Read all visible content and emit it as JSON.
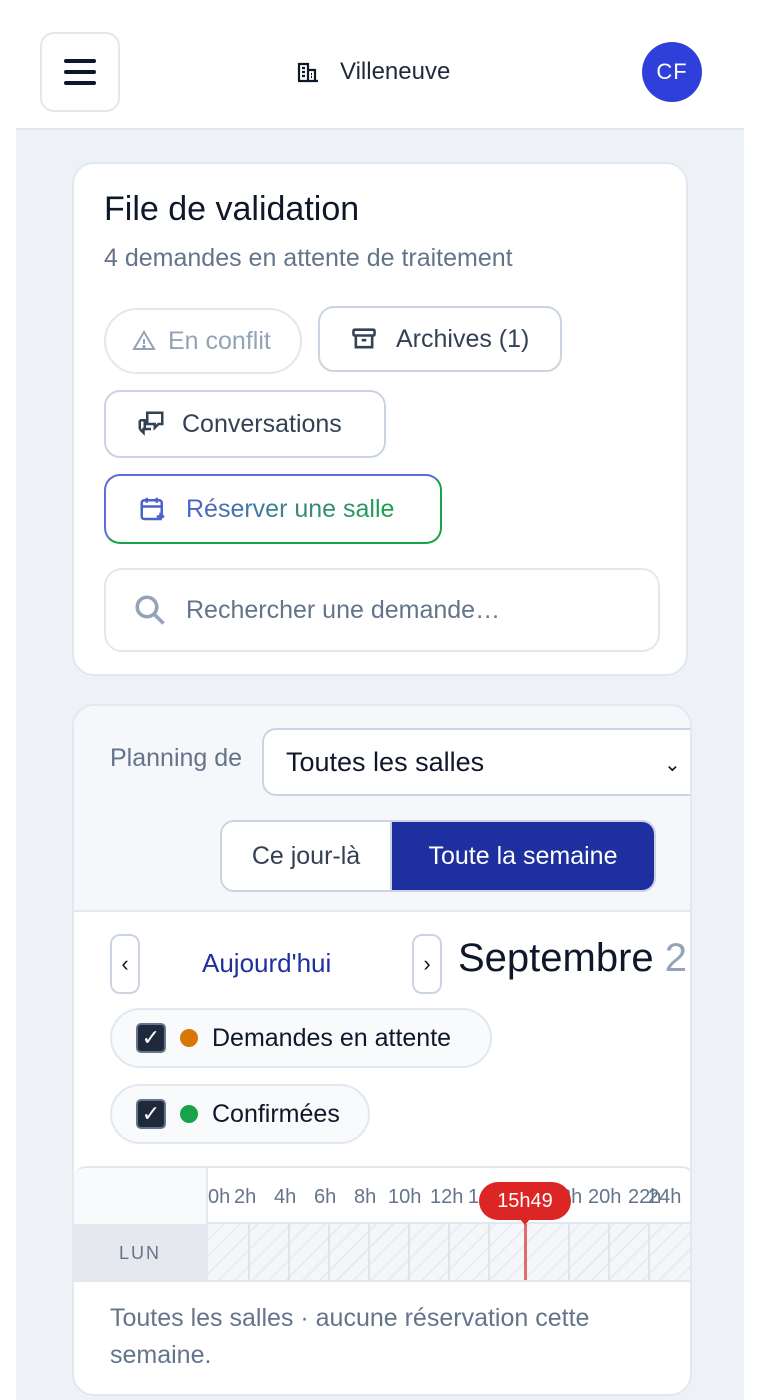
{
  "header": {
    "menu_icon": "hamburger-menu-icon",
    "site_icon": "building-icon",
    "site_name": "Villeneuve",
    "avatar_initials": "CF",
    "avatar_color": "#2f3fd9"
  },
  "queue": {
    "title": "File de validation",
    "subtitle": "4 demandes en attente de traitement",
    "buttons": {
      "conflict": "En conflit",
      "archives": "Archives (1)",
      "conversations": "Conversations",
      "reserve": "Réserver une salle"
    },
    "search_placeholder": "Rechercher une demande…"
  },
  "planning": {
    "label": "Planning de",
    "room_select": "Toutes les salles",
    "view_options": [
      "Ce jour-là",
      "Toute la semaine"
    ],
    "active_view": "Toute la semaine",
    "today_label": "Aujourd'hui",
    "month_label": "Septembre",
    "year_partial": "2",
    "filters": [
      {
        "label": "Demandes en attente",
        "checked": true,
        "color": "#d97706"
      },
      {
        "label": "Confirmées",
        "checked": true,
        "color": "#16a34a"
      }
    ],
    "hours": [
      "0h",
      "2h",
      "4h",
      "6h",
      "8h",
      "10h",
      "12h",
      "1",
      "8h",
      "20h",
      "22h",
      "24h"
    ],
    "now_label": "15h49",
    "days": [
      "LUN"
    ],
    "empty_message": "Toutes les salles · aucune réservation cette semaine.",
    "accent_color": "#1e2fa0",
    "now_color": "#dc2626"
  }
}
